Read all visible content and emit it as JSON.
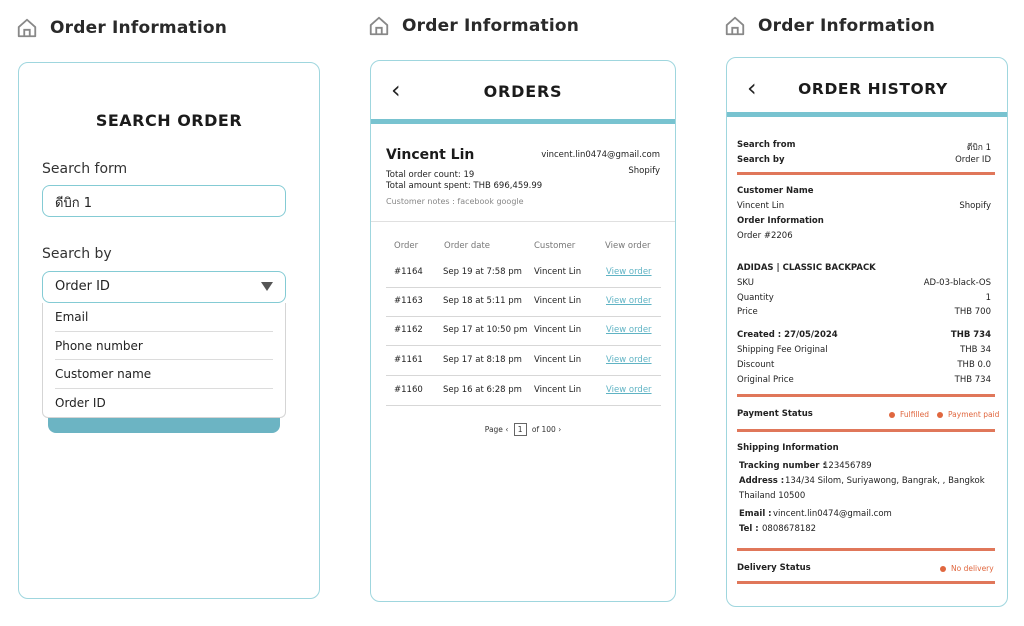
{
  "section_title": "Order Information",
  "search": {
    "title": "SEARCH ORDER",
    "form_label": "Search form",
    "form_value": "ดีบิก 1",
    "by_label": "Search by",
    "by_value": "Order ID",
    "options": [
      "Email",
      "Phone number",
      "Customer name",
      "Order ID"
    ]
  },
  "orders": {
    "title": "ORDERS",
    "customer_name": "Vincent Lin",
    "email": "vincent.lin0474@gmail.com",
    "source": "Shopify",
    "total_count": "Total order count: 19",
    "total_spent": "Total amount spent: THB 696,459.99",
    "notes": "Customer notes : facebook google",
    "columns": [
      "Order",
      "Order date",
      "Customer",
      "View order"
    ],
    "rows": [
      {
        "order": "#1164",
        "date": "Sep 19 at 7:58 pm",
        "customer": "Vincent Lin",
        "link": "View order"
      },
      {
        "order": "#1163",
        "date": "Sep 18 at 5:11 pm",
        "customer": "Vincent Lin",
        "link": "View order"
      },
      {
        "order": "#1162",
        "date": "Sep 17 at 10:50 pm",
        "customer": "Vincent Lin",
        "link": "View order"
      },
      {
        "order": "#1161",
        "date": "Sep 17 at 8:18 pm",
        "customer": "Vincent Lin",
        "link": "View order"
      },
      {
        "order": "#1160",
        "date": "Sep 16 at 6:28 pm",
        "customer": "Vincent Lin",
        "link": "View order"
      }
    ],
    "pager": {
      "label": "Page",
      "current": "1",
      "of": "of",
      "total": "100"
    }
  },
  "history": {
    "title": "ORDER HISTORY",
    "search_from_label": "Search from",
    "search_from_value": "ดีบิก 1",
    "search_by_label": "Search by",
    "search_by_value": "Order ID",
    "customer_name_label": "Customer Name",
    "customer_name": "Vincent Lin",
    "customer_source": "Shopify",
    "order_info_label": "Order Information",
    "order_number": "Order #2206",
    "product": "ADIDAS | CLASSIC BACKPACK",
    "sku_label": "SKU",
    "sku_value": "AD-03-black-OS",
    "qty_label": "Quantity",
    "qty_value": "1",
    "price_label": "Price",
    "price_value": "THB 700",
    "created_label": "Created : 27/05/2024",
    "created_value": "THB 734",
    "shipping_fee_label": "Shipping Fee Original",
    "shipping_fee_value": "THB 34",
    "discount_label": "Discount",
    "discount_value": "THB 0.0",
    "original_price_label": "Original Price",
    "original_price_value": "THB 734",
    "payment_status_label": "Payment Status",
    "payment_badge_1": "Fulfilled",
    "payment_badge_2": "Payment paid",
    "shipping_info_label": "Shipping Information",
    "tracking_label": "Tracking number :",
    "tracking_value": "123456789",
    "address_label": "Address :",
    "address_value": "134/34 Silom, Suriyawong, Bangrak, , Bangkok",
    "address_line2": "Thailand 10500",
    "email_label": "Email :",
    "email_value": "vincent.lin0474@gmail.com",
    "tel_label": "Tel :",
    "tel_value": "0808678182",
    "delivery_status_label": "Delivery Status",
    "delivery_badge": "No delivery"
  },
  "colors": {
    "accent": "#78c3d0",
    "status": "#e0673f",
    "border": "#9fd6de"
  }
}
